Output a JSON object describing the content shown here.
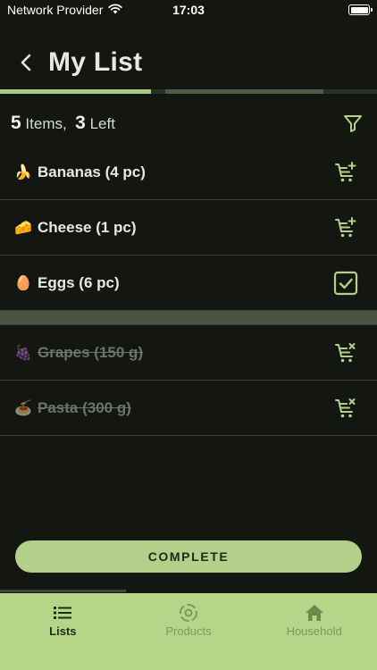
{
  "status_bar": {
    "carrier": "Network Provider",
    "time": "17:03"
  },
  "header": {
    "title": "My List"
  },
  "summary": {
    "items_count": "5",
    "items_label": "Items,",
    "left_count": "3",
    "left_label": "Left"
  },
  "progress": {
    "completed_fraction": 0.4
  },
  "items": [
    {
      "emoji": "🍌",
      "label": "Bananas (4 pc)",
      "action_icon": "add-to-cart-icon",
      "done": false
    },
    {
      "emoji": "🧀",
      "label": "Cheese (1 pc)",
      "action_icon": "add-to-cart-icon",
      "done": false
    },
    {
      "emoji": "🥚",
      "label": "Eggs (6 pc)",
      "action_icon": "checkbox-checked-icon",
      "done": false
    },
    {
      "emoji": "🍇",
      "label": "Grapes (150 g)",
      "action_icon": "remove-from-cart-icon",
      "done": true
    },
    {
      "emoji": "🍝",
      "label": "Pasta (300 g)",
      "action_icon": "remove-from-cart-icon",
      "done": true
    }
  ],
  "complete_button": {
    "label": "COMPLETE"
  },
  "tabs": [
    {
      "label": "Lists",
      "icon": "list-icon",
      "active": true
    },
    {
      "label": "Products",
      "icon": "products-icon",
      "active": false
    },
    {
      "label": "Household",
      "icon": "home-icon",
      "active": false
    }
  ],
  "colors": {
    "background": "#141711",
    "accent": "#b2d08a",
    "tab_bar": "#b5d589",
    "progress_done": "#a9c987",
    "progress_remaining": "#4f5b44"
  }
}
